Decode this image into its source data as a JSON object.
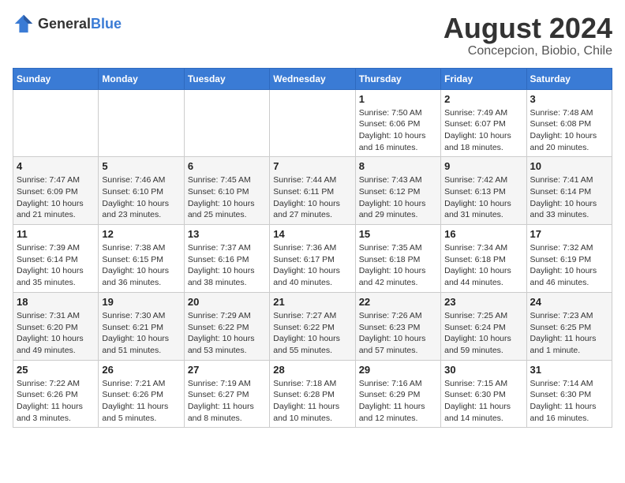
{
  "header": {
    "logo_general": "General",
    "logo_blue": "Blue",
    "title": "August 2024",
    "subtitle": "Concepcion, Biobio, Chile"
  },
  "days_of_week": [
    "Sunday",
    "Monday",
    "Tuesday",
    "Wednesday",
    "Thursday",
    "Friday",
    "Saturday"
  ],
  "weeks": [
    [
      {
        "day": "",
        "info": ""
      },
      {
        "day": "",
        "info": ""
      },
      {
        "day": "",
        "info": ""
      },
      {
        "day": "",
        "info": ""
      },
      {
        "day": "1",
        "info": "Sunrise: 7:50 AM\nSunset: 6:06 PM\nDaylight: 10 hours\nand 16 minutes."
      },
      {
        "day": "2",
        "info": "Sunrise: 7:49 AM\nSunset: 6:07 PM\nDaylight: 10 hours\nand 18 minutes."
      },
      {
        "day": "3",
        "info": "Sunrise: 7:48 AM\nSunset: 6:08 PM\nDaylight: 10 hours\nand 20 minutes."
      }
    ],
    [
      {
        "day": "4",
        "info": "Sunrise: 7:47 AM\nSunset: 6:09 PM\nDaylight: 10 hours\nand 21 minutes."
      },
      {
        "day": "5",
        "info": "Sunrise: 7:46 AM\nSunset: 6:10 PM\nDaylight: 10 hours\nand 23 minutes."
      },
      {
        "day": "6",
        "info": "Sunrise: 7:45 AM\nSunset: 6:10 PM\nDaylight: 10 hours\nand 25 minutes."
      },
      {
        "day": "7",
        "info": "Sunrise: 7:44 AM\nSunset: 6:11 PM\nDaylight: 10 hours\nand 27 minutes."
      },
      {
        "day": "8",
        "info": "Sunrise: 7:43 AM\nSunset: 6:12 PM\nDaylight: 10 hours\nand 29 minutes."
      },
      {
        "day": "9",
        "info": "Sunrise: 7:42 AM\nSunset: 6:13 PM\nDaylight: 10 hours\nand 31 minutes."
      },
      {
        "day": "10",
        "info": "Sunrise: 7:41 AM\nSunset: 6:14 PM\nDaylight: 10 hours\nand 33 minutes."
      }
    ],
    [
      {
        "day": "11",
        "info": "Sunrise: 7:39 AM\nSunset: 6:14 PM\nDaylight: 10 hours\nand 35 minutes."
      },
      {
        "day": "12",
        "info": "Sunrise: 7:38 AM\nSunset: 6:15 PM\nDaylight: 10 hours\nand 36 minutes."
      },
      {
        "day": "13",
        "info": "Sunrise: 7:37 AM\nSunset: 6:16 PM\nDaylight: 10 hours\nand 38 minutes."
      },
      {
        "day": "14",
        "info": "Sunrise: 7:36 AM\nSunset: 6:17 PM\nDaylight: 10 hours\nand 40 minutes."
      },
      {
        "day": "15",
        "info": "Sunrise: 7:35 AM\nSunset: 6:18 PM\nDaylight: 10 hours\nand 42 minutes."
      },
      {
        "day": "16",
        "info": "Sunrise: 7:34 AM\nSunset: 6:18 PM\nDaylight: 10 hours\nand 44 minutes."
      },
      {
        "day": "17",
        "info": "Sunrise: 7:32 AM\nSunset: 6:19 PM\nDaylight: 10 hours\nand 46 minutes."
      }
    ],
    [
      {
        "day": "18",
        "info": "Sunrise: 7:31 AM\nSunset: 6:20 PM\nDaylight: 10 hours\nand 49 minutes."
      },
      {
        "day": "19",
        "info": "Sunrise: 7:30 AM\nSunset: 6:21 PM\nDaylight: 10 hours\nand 51 minutes."
      },
      {
        "day": "20",
        "info": "Sunrise: 7:29 AM\nSunset: 6:22 PM\nDaylight: 10 hours\nand 53 minutes."
      },
      {
        "day": "21",
        "info": "Sunrise: 7:27 AM\nSunset: 6:22 PM\nDaylight: 10 hours\nand 55 minutes."
      },
      {
        "day": "22",
        "info": "Sunrise: 7:26 AM\nSunset: 6:23 PM\nDaylight: 10 hours\nand 57 minutes."
      },
      {
        "day": "23",
        "info": "Sunrise: 7:25 AM\nSunset: 6:24 PM\nDaylight: 10 hours\nand 59 minutes."
      },
      {
        "day": "24",
        "info": "Sunrise: 7:23 AM\nSunset: 6:25 PM\nDaylight: 11 hours\nand 1 minute."
      }
    ],
    [
      {
        "day": "25",
        "info": "Sunrise: 7:22 AM\nSunset: 6:26 PM\nDaylight: 11 hours\nand 3 minutes."
      },
      {
        "day": "26",
        "info": "Sunrise: 7:21 AM\nSunset: 6:26 PM\nDaylight: 11 hours\nand 5 minutes."
      },
      {
        "day": "27",
        "info": "Sunrise: 7:19 AM\nSunset: 6:27 PM\nDaylight: 11 hours\nand 8 minutes."
      },
      {
        "day": "28",
        "info": "Sunrise: 7:18 AM\nSunset: 6:28 PM\nDaylight: 11 hours\nand 10 minutes."
      },
      {
        "day": "29",
        "info": "Sunrise: 7:16 AM\nSunset: 6:29 PM\nDaylight: 11 hours\nand 12 minutes."
      },
      {
        "day": "30",
        "info": "Sunrise: 7:15 AM\nSunset: 6:30 PM\nDaylight: 11 hours\nand 14 minutes."
      },
      {
        "day": "31",
        "info": "Sunrise: 7:14 AM\nSunset: 6:30 PM\nDaylight: 11 hours\nand 16 minutes."
      }
    ]
  ]
}
